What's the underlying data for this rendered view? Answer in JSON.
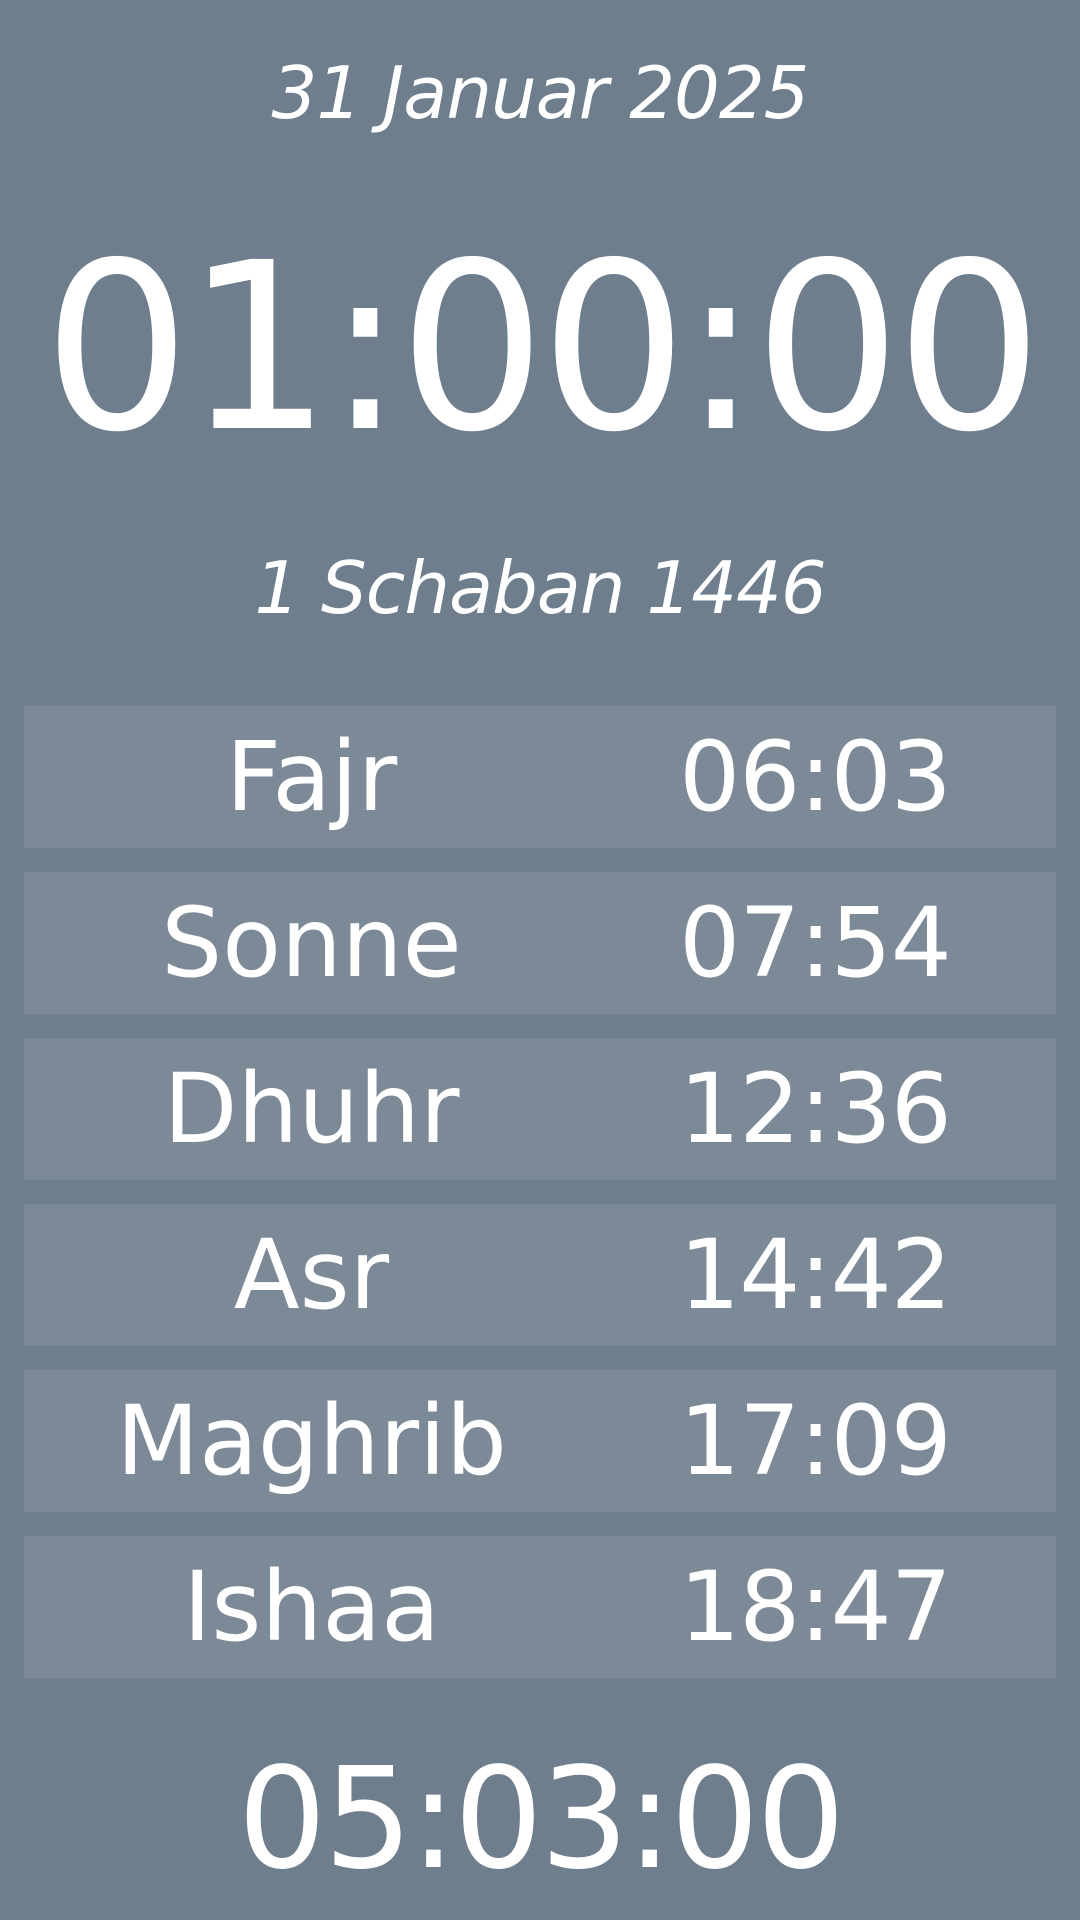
{
  "gregorian_date": "31 Januar 2025",
  "current_time": "01:00:00",
  "hijri_date": "1 Schaban 1446",
  "prayers": [
    {
      "name": "Fajr",
      "time": "06:03"
    },
    {
      "name": "Sonne",
      "time": "07:54"
    },
    {
      "name": "Dhuhr",
      "time": "12:36"
    },
    {
      "name": "Asr",
      "time": "14:42"
    },
    {
      "name": "Maghrib",
      "time": "17:09"
    },
    {
      "name": "Ishaa",
      "time": "18:47"
    }
  ],
  "countdown": "05:03:00",
  "colors": {
    "background": "#6e7e8d",
    "row_background": "#7c8a97",
    "text": "#ffffff"
  }
}
